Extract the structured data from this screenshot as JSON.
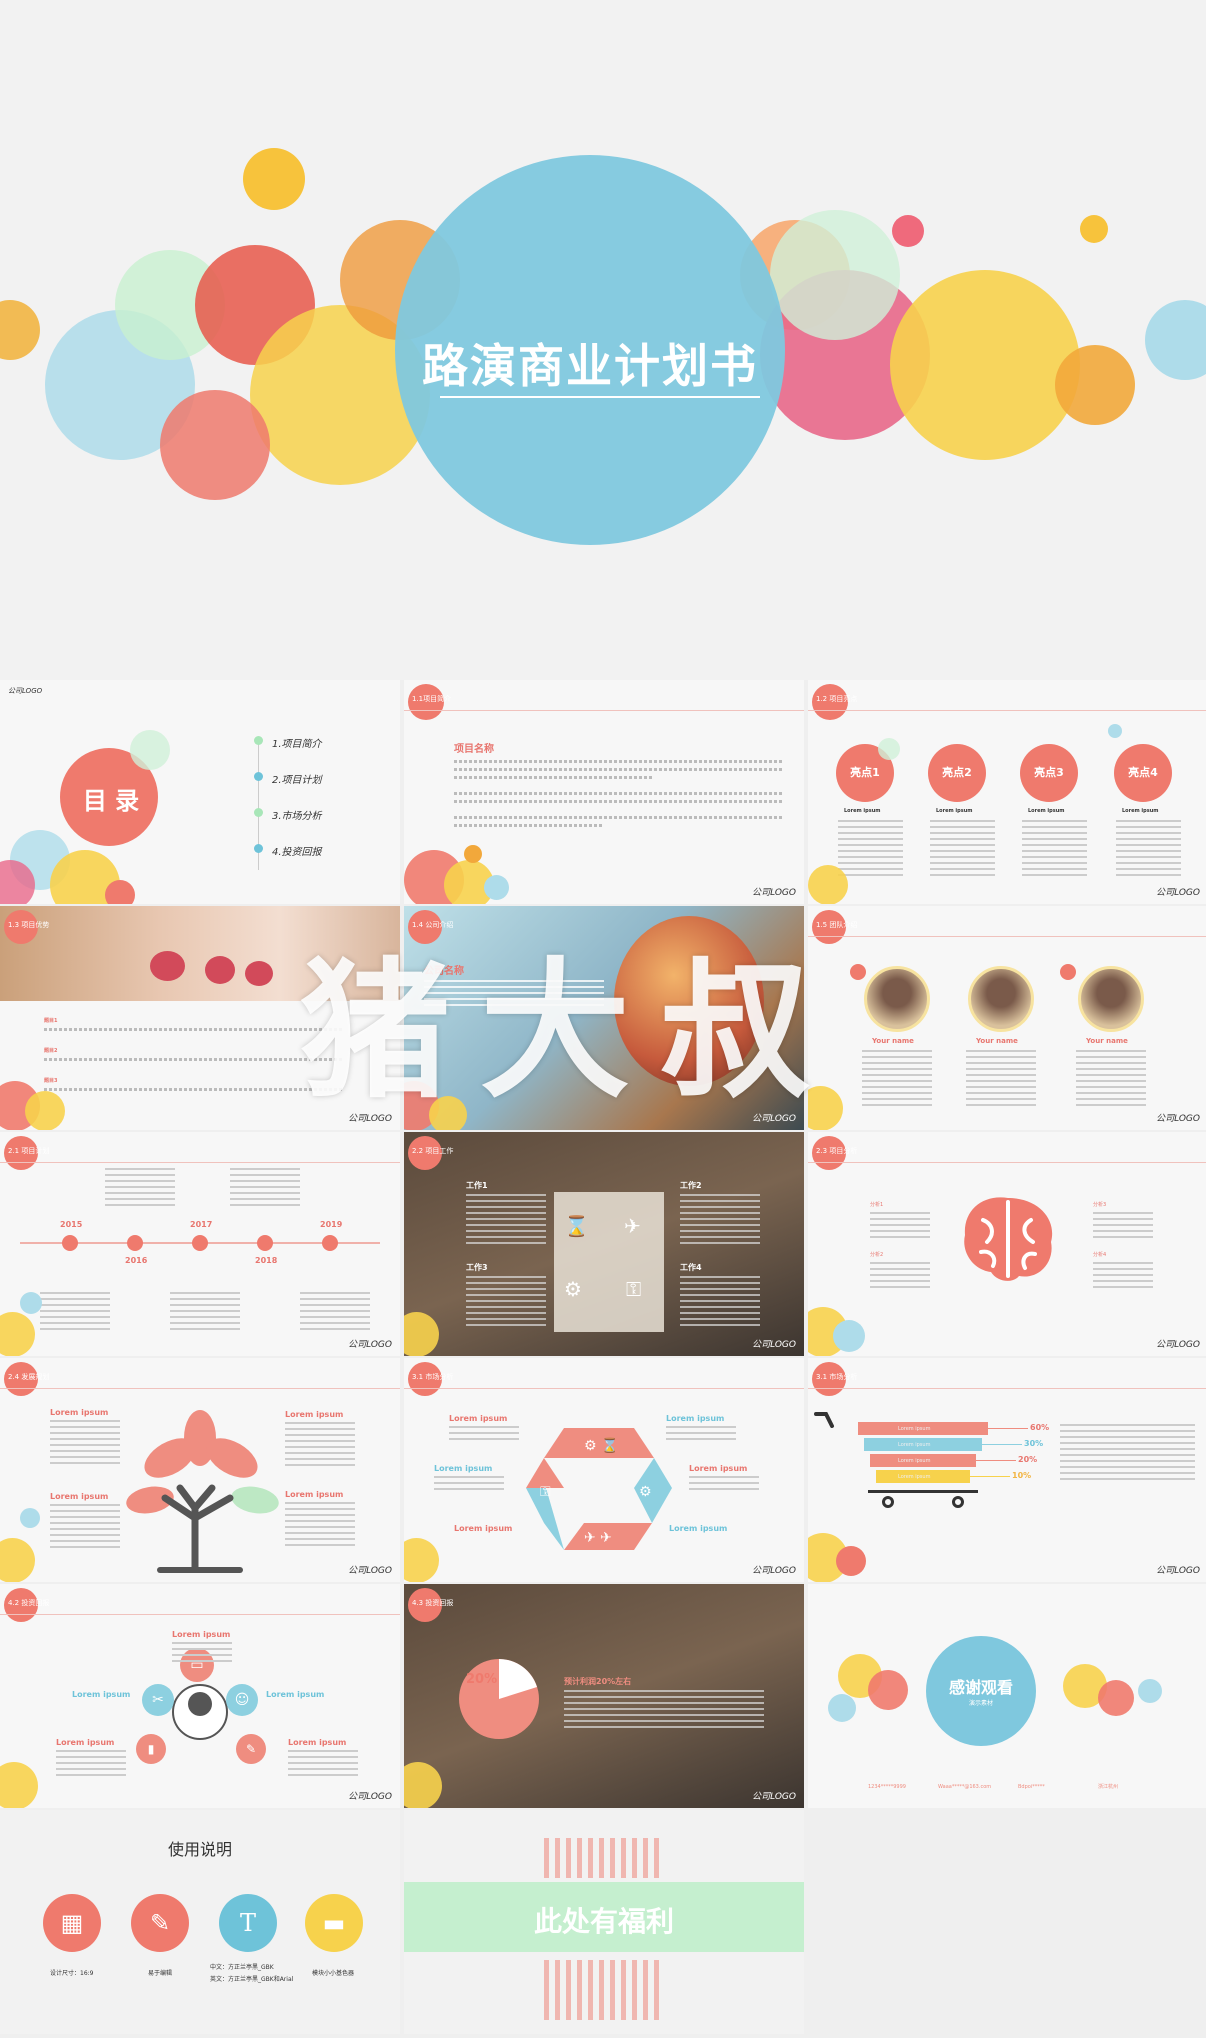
{
  "hero": {
    "title": "路演商业计划书"
  },
  "contents": {
    "logo_corner": "公司LOGO",
    "title": "目 录",
    "items": [
      "1.项目简介",
      "2.项目计划",
      "3.市场分析",
      "4.投资回报"
    ]
  },
  "slide_intro": {
    "header": "1.1项目简介",
    "heading": "项目名称",
    "logo": "公司LOGO"
  },
  "slide_highlights": {
    "header": "1.2 项目亮点",
    "items": [
      "亮点1",
      "亮点2",
      "亮点3",
      "亮点4"
    ],
    "caption": "Lorem ipsum",
    "logo": "公司LOGO"
  },
  "slide_features": {
    "header": "1.3 项目优势",
    "labels": [
      "题目1",
      "题目2",
      "题目3"
    ],
    "logo": "公司LOGO"
  },
  "slide_photo": {
    "header": "1.4 公司介绍",
    "heading": "公司名称",
    "logo": "公司LOGO"
  },
  "slide_team": {
    "header": "1.5 团队介绍",
    "names": [
      "Your name",
      "Your name",
      "Your name"
    ],
    "logo": "公司LOGO"
  },
  "slide_timeline": {
    "header": "2.1 项目计划",
    "years": [
      "2015",
      "2016",
      "2017",
      "2018",
      "2019"
    ],
    "logo": "公司LOGO"
  },
  "slide_work": {
    "header": "2.2 项目工作",
    "items": [
      "工作1",
      "工作2",
      "工作3",
      "工作4"
    ],
    "logo": "公司LOGO"
  },
  "slide_brain": {
    "header": "2.3 项目分析",
    "items": [
      "分析1",
      "分析2",
      "分析3",
      "分析4"
    ],
    "logo": "公司LOGO"
  },
  "slide_tree": {
    "header": "2.4 发展规划",
    "items": [
      "Lorem ipsum",
      "Lorem ipsum",
      "Lorem ipsum",
      "Lorem ipsum"
    ],
    "logo": "公司LOGO"
  },
  "slide_cycle": {
    "header": "3.1 市场分析",
    "items": [
      "Lorem ipsum",
      "Lorem ipsum",
      "Lorem ipsum",
      "Lorem ipsum",
      "Lorem ipsum",
      "Lorem ipsum"
    ],
    "logo": "公司LOGO"
  },
  "slide_cart": {
    "header": "3.1 市场分析",
    "bars": [
      "Lorem ipsum",
      "Lorem ipsum",
      "Lorem ipsum",
      "Lorem ipsum"
    ],
    "percents": [
      "60%",
      "30%",
      "20%",
      "10%"
    ],
    "logo": "公司LOGO"
  },
  "slide_person": {
    "header": "4.2 投资回报",
    "items": [
      "Lorem ipsum",
      "Lorem ipsum",
      "Lorem ipsum",
      "Lorem ipsum",
      "Lorem ipsum"
    ],
    "logo": "公司LOGO"
  },
  "slide_pie": {
    "header": "4.3 投资回报",
    "percent": "20%",
    "heading": "预计利润20%左右",
    "logo": "公司LOGO"
  },
  "slide_thanks": {
    "title": "感谢观看",
    "subtitle": "演示素材",
    "footer": [
      "1234*****9999",
      "Waaa*****@163.com",
      "Bdpoi*****",
      "浙江杭州"
    ]
  },
  "usage": {
    "title": "使用说明",
    "captions": [
      "设计尺寸：16:9",
      "易于编辑",
      "中文：方正兰亭黑_GBK",
      "英文：方正兰亭黑_GBK和Arial",
      "模块小小基色器"
    ],
    "icon_letter": "T"
  },
  "bonus": {
    "title": "此处有福利"
  },
  "watermark": {
    "text": "猪大叔"
  }
}
